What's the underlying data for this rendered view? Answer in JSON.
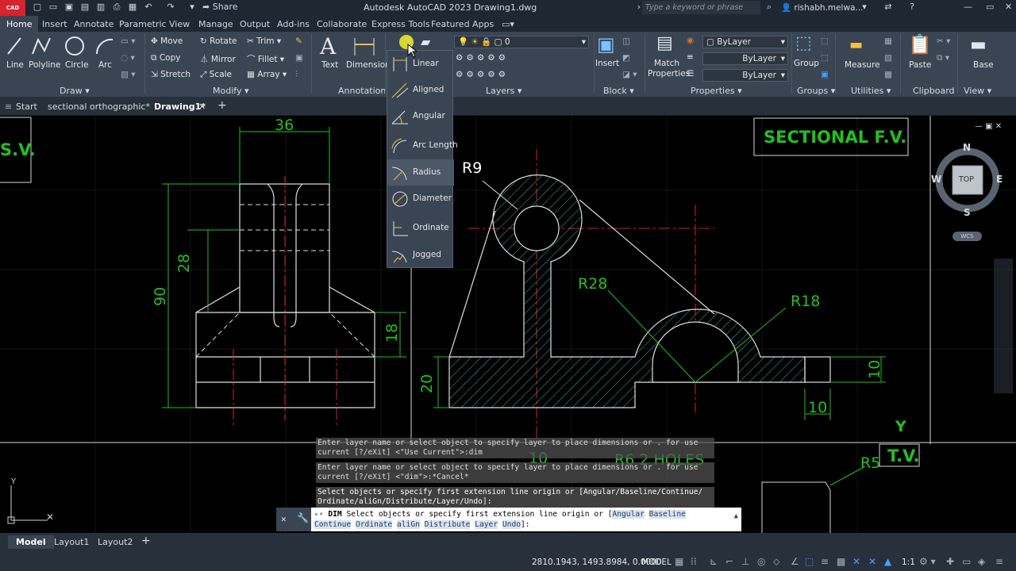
{
  "title_bar": {
    "app_logo": "CAD",
    "share": "Share",
    "title": "Autodesk AutoCAD 2023    Drawing1.dwg",
    "search_placeholder": "Type a keyword or phrase",
    "user": "rishabh.melwa..."
  },
  "ribbon_tabs": [
    "Home",
    "Insert",
    "Annotate",
    "Parametric",
    "View",
    "Manage",
    "Output",
    "Add-ins",
    "Collaborate",
    "Express Tools",
    "Featured Apps"
  ],
  "ribbon": {
    "draw": {
      "label": "Draw",
      "line": "Line",
      "polyline": "Polyline",
      "circle": "Circle",
      "arc": "Arc"
    },
    "modify": {
      "label": "Modify",
      "move": "Move",
      "rotate": "Rotate",
      "trim": "Trim",
      "copy": "Copy",
      "mirror": "Mirror",
      "fillet": "Fillet",
      "stretch": "Stretch",
      "scale": "Scale",
      "array": "Array"
    },
    "annotation": {
      "label": "Annotation",
      "text": "Text",
      "dimension": "Dimension"
    },
    "layers": {
      "label": "Layers",
      "current": "0"
    },
    "block": {
      "label": "Block",
      "insert": "Insert"
    },
    "properties": {
      "label": "Properties",
      "match": "Match",
      "match2": "Properties",
      "color": "ByLayer",
      "linetype": "ByLayer",
      "lineweight": "ByLayer"
    },
    "groups": {
      "label": "Groups",
      "group": "Group"
    },
    "utilities": {
      "label": "Utilities",
      "measure": "Measure"
    },
    "clipboard": {
      "label": "Clipboard",
      "paste": "Paste"
    },
    "view": {
      "label": "View",
      "base": "Base"
    }
  },
  "dimension_menu": [
    "Linear",
    "Aligned",
    "Angular",
    "Arc Length",
    "Radius",
    "Diameter",
    "Ordinate",
    "Jogged"
  ],
  "doc_tabs": {
    "start": "Start",
    "tab1": "sectional orthographic*",
    "tab2": "Drawing1*"
  },
  "drawing": {
    "sectional_fv": "SECTIONAL F.V.",
    "sv": "S.V.",
    "tv": "T.V.",
    "y": "Y",
    "dims": {
      "d36": "36",
      "d28": "28",
      "d90": "90",
      "d18": "18",
      "d20": "20",
      "r9": "R9",
      "r28": "R28",
      "r18": "R18",
      "d10a": "10",
      "d10b": "10",
      "d10c": "10",
      "r6": "R6 2 HOLES",
      "r5": "R5"
    }
  },
  "viewcube": {
    "n": "N",
    "s": "S",
    "e": "E",
    "w": "W",
    "top": "TOP",
    "wcs": "WCS"
  },
  "command": {
    "history": [
      "Enter layer name or select object to specify layer to place dimensions or . for use\ncurrent [?/eXit] <\"Use Current\">:dim",
      "Enter layer name or select object to specify layer to place dimensions or . for use\ncurrent [?/eXit] <\"dim\">:*Cancel*",
      "Select objects or specify first extension line origin or [Angular/Baseline/Continue/\nOrdinate/aliGn/Distribute/Layer/Undo]:"
    ],
    "prompt_cmd": "DIM",
    "prompt": " Select objects or specify first extension line origin or [",
    "opt_angular": "Angular",
    "opt_baseline": "Baseline",
    "opt_continue": "Continue",
    "opt_ordinate": "Ordinate",
    "opt_align": "aliGn",
    "opt_distribute": "Distribute",
    "opt_layer": "Layer",
    "opt_undo": "Undo",
    "end": "]:"
  },
  "status": {
    "model_tab": "Model",
    "layout1": "Layout1",
    "layout2": "Layout2",
    "coords": "2810.1943, 1493.8984, 0.0000",
    "model": "MODEL",
    "scale": "1:1"
  }
}
